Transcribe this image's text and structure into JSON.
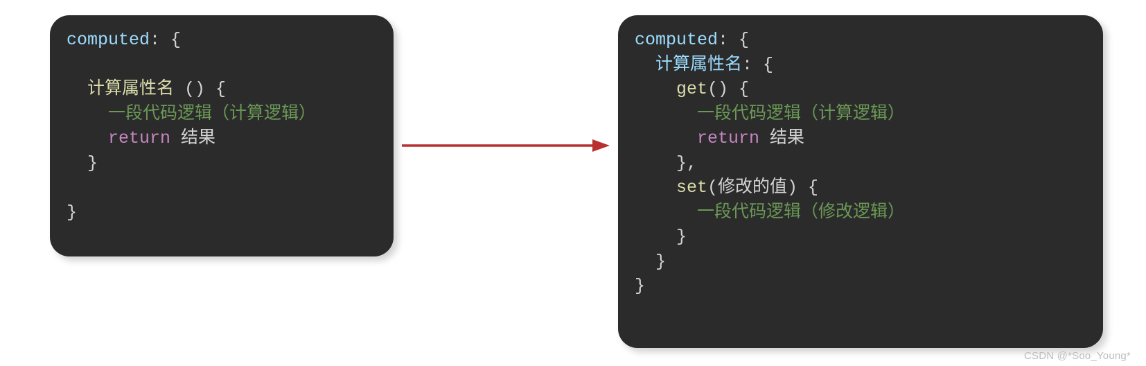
{
  "left": {
    "l1_key": "computed",
    "l1_rest": ": {",
    "l2_fn": "计算属性名",
    "l2_rest": " () {",
    "l3_cmt": "一段代码逻辑（计算逻辑）",
    "l4_ret": "return",
    "l4_rest": " 结果",
    "l5": "}",
    "l6": "}"
  },
  "right": {
    "l1_key": "computed",
    "l1_rest": ": {",
    "l2_key": "计算属性名",
    "l2_rest": ": {",
    "l3_fn": "get",
    "l3_rest": "() {",
    "l4_cmt": "一段代码逻辑（计算逻辑）",
    "l5_ret": "return",
    "l5_rest": " 结果",
    "l6": "},",
    "l7_fn": "set",
    "l7_rest": "(修改的值) {",
    "l8_cmt": "一段代码逻辑（修改逻辑）",
    "l9": "}",
    "l10": "}",
    "l11": "}"
  },
  "arrow_color": "#b73131",
  "watermark": "CSDN @*Soo_Young*"
}
